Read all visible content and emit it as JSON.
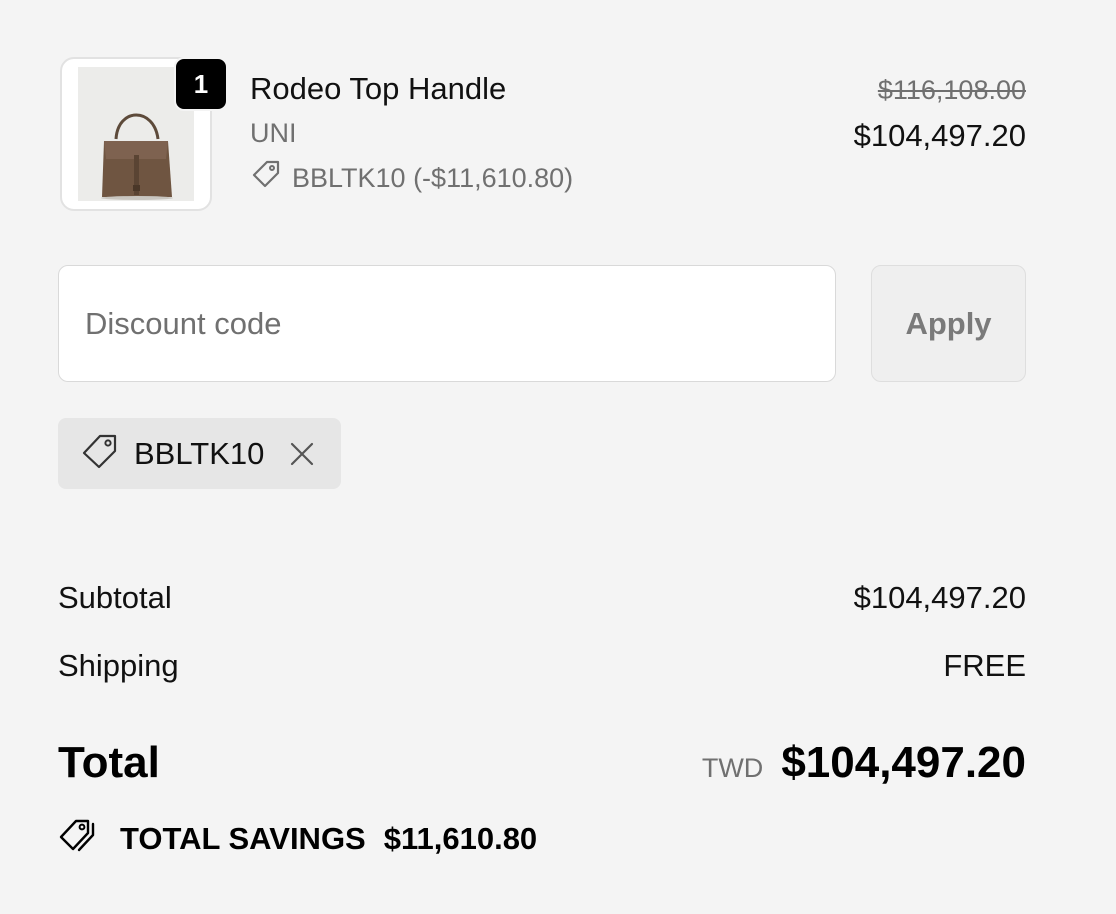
{
  "line_item": {
    "quantity": "1",
    "name": "Rodeo Top Handle",
    "variant": "UNI",
    "discount": "BBLTK10 (-$11,610.80)",
    "price_original": "$116,108.00",
    "price_current": "$104,497.20",
    "image_icon": "handbag-image"
  },
  "discount_form": {
    "placeholder": "Discount code",
    "value": "",
    "apply_label": "Apply"
  },
  "applied_code": {
    "label": "BBLTK10",
    "tag_icon": "tag-icon",
    "remove_icon": "close-icon"
  },
  "summary": {
    "subtotal_label": "Subtotal",
    "subtotal_value": "$104,497.20",
    "shipping_label": "Shipping",
    "shipping_value": "FREE",
    "total_label": "Total",
    "total_currency": "TWD",
    "total_value": "$104,497.20",
    "savings_label": "TOTAL SAVINGS",
    "savings_value": "$11,610.80",
    "savings_icon": "tags-icon"
  },
  "colors": {
    "background": "#f4f4f4",
    "muted_text": "#707070",
    "badge": "#000000"
  }
}
